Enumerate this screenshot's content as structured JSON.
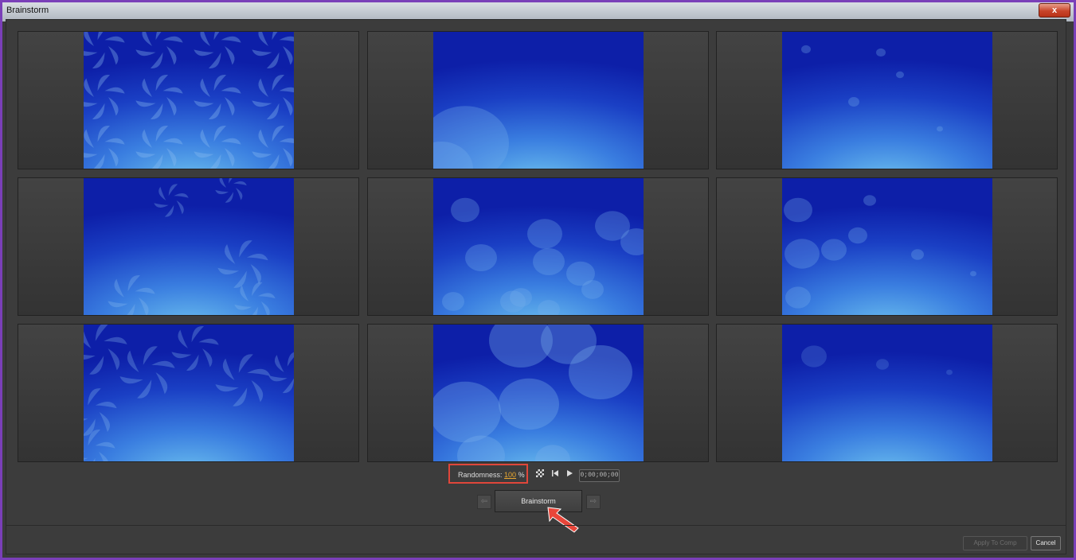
{
  "window": {
    "title": "Brainstorm",
    "close_label": "x"
  },
  "tiles": [
    {
      "pattern": "swirl-grid"
    },
    {
      "pattern": "blob-corner"
    },
    {
      "pattern": "dots-sparse"
    },
    {
      "pattern": "swirl-scatter"
    },
    {
      "pattern": "blob-cluster"
    },
    {
      "pattern": "dots-blobs"
    },
    {
      "pattern": "swirl-row"
    },
    {
      "pattern": "blob-large"
    },
    {
      "pattern": "dots-faint"
    }
  ],
  "controls": {
    "randomness_label": "Randomness:",
    "randomness_value": "100",
    "randomness_unit": "%",
    "timecode": "0;00;00;00",
    "brainstorm_label": "Brainstorm",
    "apply_label": "Apply To Comp",
    "cancel_label": "Cancel"
  },
  "colors": {
    "accent_highlight": "#e0463a",
    "value_orange": "#e9a730",
    "frame_purple": "#7a3fb8"
  }
}
